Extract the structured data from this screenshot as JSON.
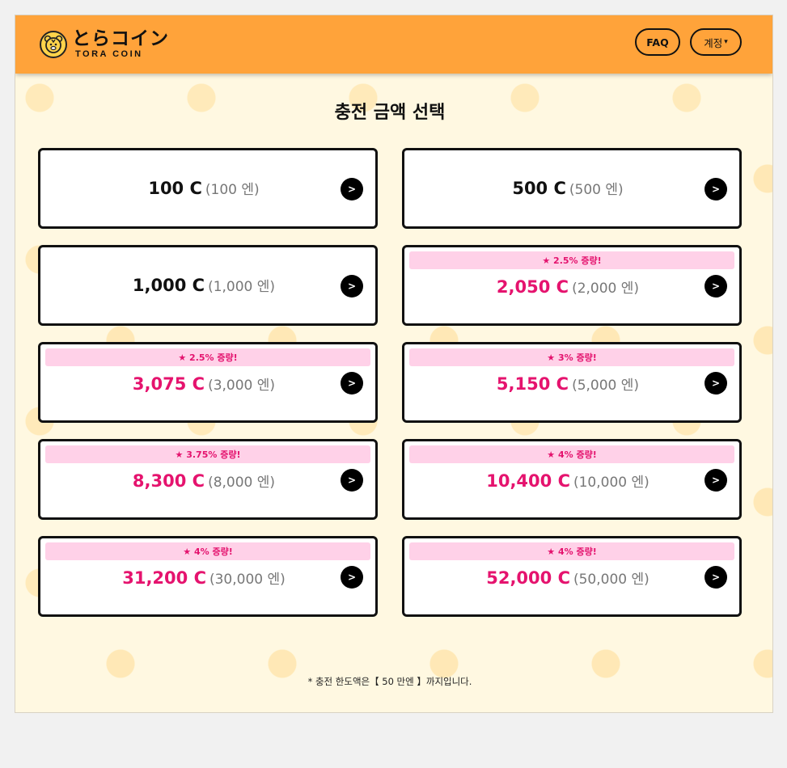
{
  "header": {
    "logo_text": "とらコイン",
    "logo_sub": "TORA COIN",
    "faq_label": "FAQ",
    "account_label": "계정",
    "account_caret": "▾"
  },
  "page": {
    "title": "충전 금액 선택",
    "arrow_glyph": ">",
    "note": "* 충전 한도액은【 50 만엔 】까지입니다."
  },
  "options": [
    {
      "coins": "100 C",
      "yen": "(100 엔)",
      "bonus": null
    },
    {
      "coins": "500 C",
      "yen": "(500 엔)",
      "bonus": null
    },
    {
      "coins": "1,000 C",
      "yen": "(1,000 엔)",
      "bonus": null
    },
    {
      "coins": "2,050 C",
      "yen": "(2,000 엔)",
      "bonus": "★ 2.5% 증량!"
    },
    {
      "coins": "3,075 C",
      "yen": "(3,000 엔)",
      "bonus": "★ 2.5% 증량!"
    },
    {
      "coins": "5,150 C",
      "yen": "(5,000 엔)",
      "bonus": "★ 3% 증량!"
    },
    {
      "coins": "8,300 C",
      "yen": "(8,000 엔)",
      "bonus": "★ 3.75% 증량!"
    },
    {
      "coins": "10,400 C",
      "yen": "(10,000 엔)",
      "bonus": "★ 4% 증량!"
    },
    {
      "coins": "31,200 C",
      "yen": "(30,000 엔)",
      "bonus": "★ 4% 증량!"
    },
    {
      "coins": "52,000 C",
      "yen": "(50,000 엔)",
      "bonus": "★ 4% 증량!"
    }
  ],
  "colors": {
    "header_bg": "#ffa33a",
    "page_bg": "#fff8e1",
    "bonus_text": "#e5136e",
    "bonus_badge_bg": "#ffd1e8"
  }
}
